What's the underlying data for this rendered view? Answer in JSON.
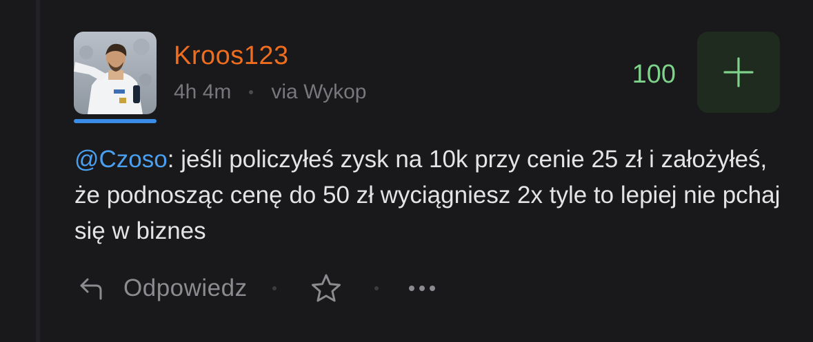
{
  "post": {
    "author": "Kroos123",
    "time_ago": "4h 4m",
    "via": "via Wykop",
    "votes": "100",
    "mention": "@Czoso",
    "text": ": jeśli policzyłeś zysk na 10k przy cenie 25 zł i założyłeś, że podnosząc cenę do 50 zł wyciągniesz 2x tyle to lepiej nie pchaj się w biznes"
  },
  "actions": {
    "reply_label": "Odpowiedz"
  },
  "icons": {
    "plus": "plus-icon",
    "reply": "reply-arrow-icon",
    "favorite": "star-icon",
    "more": "more-dots-icon"
  },
  "colors": {
    "background": "#19191b",
    "username": "#ef6d1f",
    "mention": "#4a9ff0",
    "votes": "#7ed38a",
    "plus_button_bg": "#1f2b1f",
    "avatar_underline": "#3a8de6",
    "meta": "#77777c"
  }
}
